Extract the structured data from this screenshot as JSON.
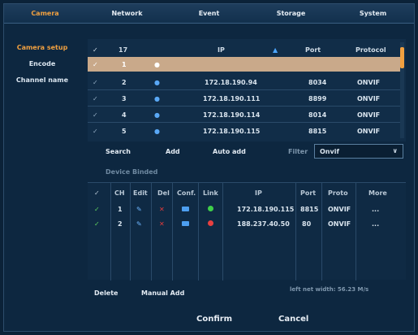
{
  "nav": {
    "tabs": [
      {
        "label": "Camera",
        "active": true
      },
      {
        "label": "Network",
        "active": false
      },
      {
        "label": "Event",
        "active": false
      },
      {
        "label": "Storage",
        "active": false
      },
      {
        "label": "System",
        "active": false
      }
    ]
  },
  "sidebar": {
    "items": [
      {
        "label": "Camera setup",
        "active": true
      },
      {
        "label": "Encode",
        "active": false
      },
      {
        "label": "Channel name",
        "active": false
      }
    ]
  },
  "discovery": {
    "header": {
      "count": "17",
      "ip": "IP",
      "port": "Port",
      "protocol": "Protocol"
    },
    "rows": [
      {
        "num": "1",
        "ip": "",
        "port": "",
        "protocol": "",
        "selected": true
      },
      {
        "num": "2",
        "ip": "172.18.190.94",
        "port": "8034",
        "protocol": "ONVIF"
      },
      {
        "num": "3",
        "ip": "172.18.190.111",
        "port": "8899",
        "protocol": "ONVIF"
      },
      {
        "num": "4",
        "ip": "172.18.190.114",
        "port": "8014",
        "protocol": "ONVIF"
      },
      {
        "num": "5",
        "ip": "172.18.190.115",
        "port": "8815",
        "protocol": "ONVIF"
      }
    ]
  },
  "actions": {
    "search": "Search",
    "add": "Add",
    "auto_add": "Auto add",
    "filter_label": "Filter",
    "filter_value": "Onvif"
  },
  "binded": {
    "title": "Device Binded",
    "header": {
      "ch": "CH",
      "edit": "Edit",
      "del": "Del",
      "conf": "Conf.",
      "link": "Link",
      "ip": "IP",
      "port": "Port",
      "proto": "Proto",
      "more": "More"
    },
    "rows": [
      {
        "ch": "1",
        "ip": "172.18.190.115",
        "port": "8815",
        "proto": "ONVIF",
        "more": "...",
        "link": "green"
      },
      {
        "ch": "2",
        "ip": "188.237.40.50",
        "port": "80",
        "proto": "ONVIF",
        "more": "...",
        "link": "red"
      }
    ]
  },
  "footer": {
    "delete": "Delete",
    "manual_add": "Manual Add",
    "bandwidth": "left net width: 56.23 M/s",
    "confirm": "Confirm",
    "cancel": "Cancel"
  },
  "colors": {
    "accent": "#f0a040",
    "bg": "#0d2740"
  }
}
